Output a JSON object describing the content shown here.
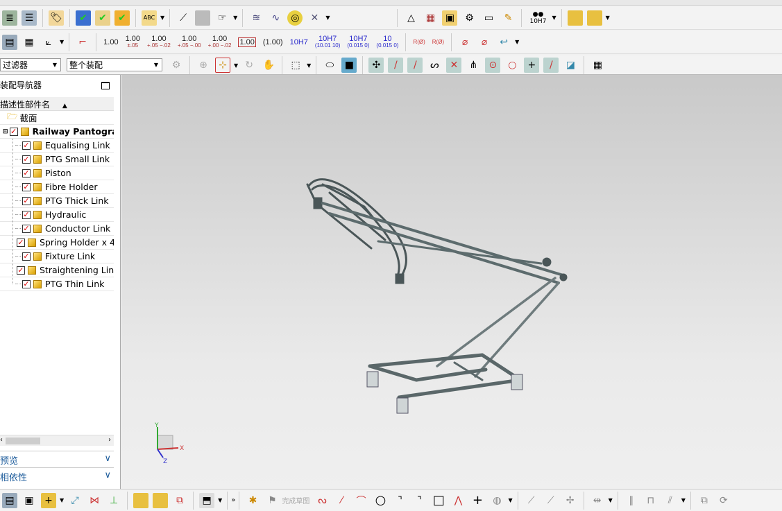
{
  "toolbar_row2": {
    "icons": [
      "layers-icon",
      "list-layers-icon",
      "tag-icon",
      "assembly-check-icon",
      "constraint-check-icon",
      "component-check-icon",
      "annotation-icon",
      "surface-icon",
      "extrude-icon",
      "pointer-icon",
      "spring-coil-icon",
      "spring-icon",
      "washer-icon",
      "crossed-icon",
      "triangle-icon",
      "table-icon",
      "image-icon",
      "gears-icon",
      "note-icon",
      "brush-icon",
      "binoculars-icon",
      "cubes-icon",
      "cubes2-icon"
    ],
    "tolerance_label": "10H7"
  },
  "toolbar_row3": {
    "dims": [
      {
        "main": "1.00",
        "sub": ""
      },
      {
        "main": "1.00",
        "sub": "±.05"
      },
      {
        "main": "1.00",
        "sub": "+.05 −.02"
      },
      {
        "main": "1.00",
        "sub": "+.05 −.00"
      },
      {
        "main": "1.00",
        "sub": "+.00 −.02"
      },
      {
        "main": "1.00",
        "sub": ""
      },
      {
        "main": "(1.00)",
        "sub": ""
      },
      {
        "main": "10H7",
        "sub": ""
      },
      {
        "main": "10H7",
        "sub": "(10.01 10)"
      },
      {
        "main": "10H7",
        "sub": "(0.015 0)"
      },
      {
        "main": "10",
        "sub": "(0.015 0)"
      }
    ],
    "radius_labels": [
      "R(Ø)",
      "R(Ø)"
    ]
  },
  "toolbar_row4": {
    "filter_select": "过滤器",
    "scope_select": "整个装配"
  },
  "navigator": {
    "title": "装配导航器",
    "column_header": "描述性部件名",
    "items": [
      {
        "label": "截面",
        "type": "folder",
        "level": 0
      },
      {
        "label": "Railway Pantograph",
        "type": "assembly",
        "level": 0,
        "checked": true
      },
      {
        "label": "Equalising Link",
        "level": 1,
        "checked": true
      },
      {
        "label": "PTG Small Link",
        "level": 1,
        "checked": true
      },
      {
        "label": "Piston",
        "level": 1,
        "checked": true
      },
      {
        "label": "Fibre Holder",
        "level": 1,
        "checked": true
      },
      {
        "label": "PTG Thick Link",
        "level": 1,
        "checked": true
      },
      {
        "label": "Hydraulic",
        "level": 1,
        "checked": true
      },
      {
        "label": "Conductor Link",
        "level": 1,
        "checked": true
      },
      {
        "label": "Spring Holder x 4",
        "level": 1,
        "checked": true
      },
      {
        "label": "Fixture Link",
        "level": 1,
        "checked": true
      },
      {
        "label": "Straightening Link",
        "level": 1,
        "checked": true
      },
      {
        "label": "PTG Thin Link",
        "level": 1,
        "checked": true
      }
    ],
    "panels": [
      "预览",
      "相依性"
    ]
  },
  "viewport": {
    "axes": {
      "x": "X",
      "y": "Y",
      "z": "Z"
    }
  },
  "bottom_toolbar": {
    "finish_sketch": "完成草图",
    "overflow": "»"
  }
}
